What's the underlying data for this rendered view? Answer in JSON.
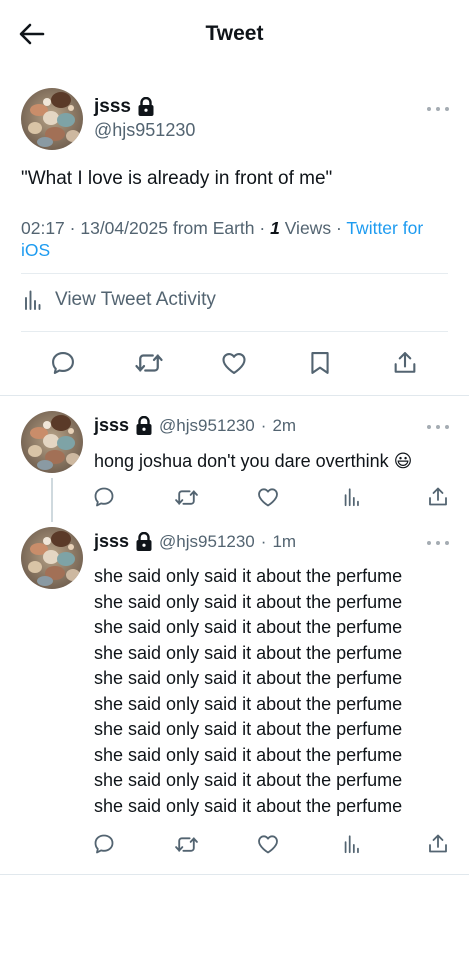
{
  "header": {
    "title": "Tweet",
    "back_icon": "arrow-left-icon"
  },
  "main_tweet": {
    "name": "jsss",
    "handle": "@hjs951230",
    "text": "\"What I love is already in front of me\"",
    "time": "02:17",
    "date": "13/04/2025",
    "location": "from Earth",
    "views_count": "1",
    "views_label": "Views",
    "source": "Twitter for iOS",
    "activity_label": "View Tweet Activity",
    "actions": [
      "reply-icon",
      "retweet-icon",
      "like-icon",
      "bookmark-icon",
      "share-icon"
    ]
  },
  "replies": [
    {
      "name": "jsss",
      "handle": "@hjs951230",
      "time": "2m",
      "lines": [
        "hong joshua don't you dare overthink 😃"
      ]
    },
    {
      "name": "jsss",
      "handle": "@hjs951230",
      "time": "1m",
      "lines": [
        "she said only said it about the perfume",
        "she said only said it about the perfume",
        "she said only said it about the perfume",
        "she said only said it about the perfume",
        "she said only said it about the perfume",
        "she said only said it about the perfume",
        "she said only said it about the perfume",
        "she said only said it about the perfume",
        "she said only said it about the perfume",
        "she said only said it about the perfume"
      ]
    }
  ],
  "colors": {
    "accent": "#1d9bf0",
    "muted": "#536471",
    "text": "#0f1419",
    "divider": "#e6ecf0"
  }
}
